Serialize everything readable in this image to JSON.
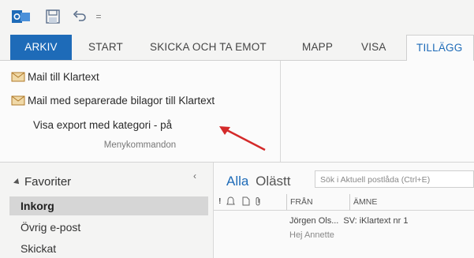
{
  "qat": {
    "more": "="
  },
  "tabs": {
    "arkiv": "ARKIV",
    "start": "START",
    "skicka": "SKICKA OCH TA EMOT",
    "mapp": "MAPP",
    "visa": "VISA",
    "tillagg": "TILLÄGG"
  },
  "ribbon": {
    "btn1": "Mail till Klartext",
    "btn2": "Mail med separerade bilagor till Klartext",
    "btn3": "Visa export med kategori - på",
    "group_label": "Menykommandon"
  },
  "nav": {
    "favorites": "Favoriter",
    "collapse": "‹",
    "items": [
      "Inkorg",
      "Övrig e-post",
      "Skickat"
    ]
  },
  "mail": {
    "filter_all": "Alla",
    "filter_unread": "Olästt",
    "search_placeholder": "Sök i Aktuell postlåda (Ctrl+E)",
    "col_importance": "!",
    "col_from": "FRÅN",
    "col_subject": "ÄMNE",
    "message": {
      "from": "Jörgen Ols...",
      "subject": "SV: iKlartext nr 1",
      "preview": "Hej Annette"
    }
  },
  "colors": {
    "accent": "#1e6bb8",
    "arrow": "#d42a2a"
  }
}
